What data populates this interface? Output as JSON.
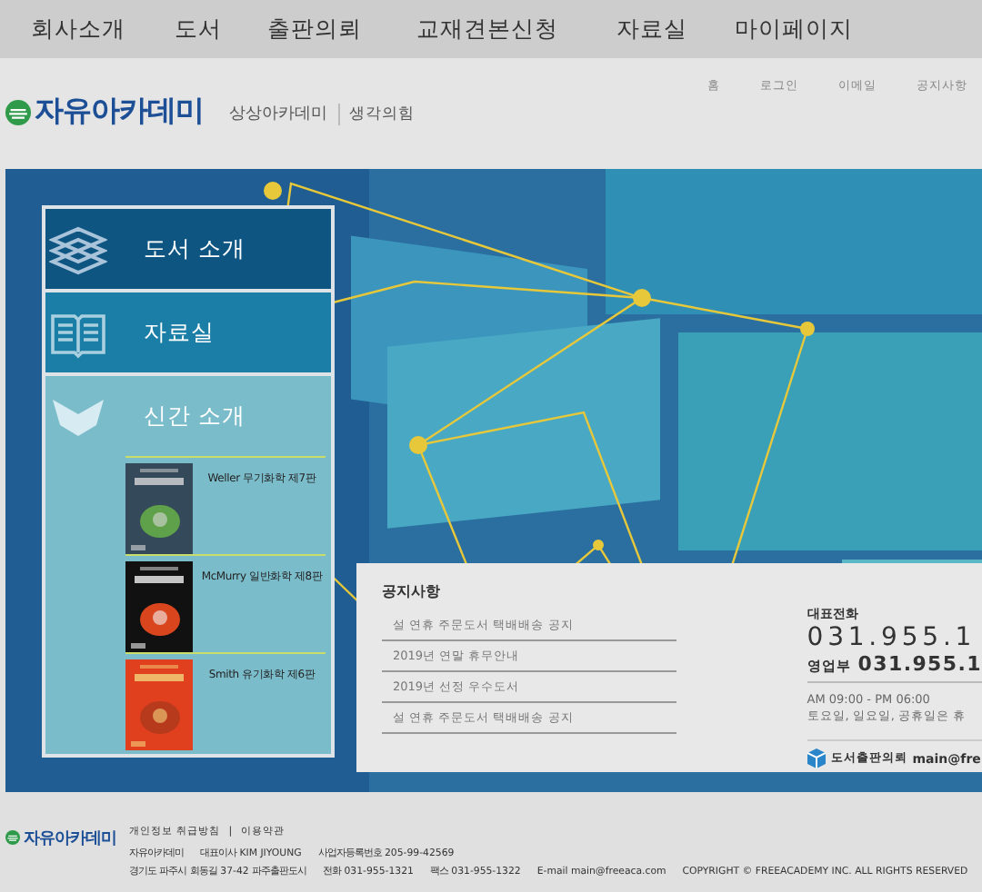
{
  "nav": {
    "items": [
      "회사소개",
      "도서",
      "출판의뢰",
      "교재견본신청",
      "자료실",
      "마이페이지"
    ]
  },
  "header": {
    "logo": "자유아카데미",
    "brands": [
      "상상아카데미",
      "생각의힘"
    ],
    "links": [
      "홈",
      "로그인",
      "이메일",
      "공지사항"
    ]
  },
  "sidebar": {
    "items": [
      {
        "label": "도서 소개",
        "kind": "books",
        "color": "#0e5582"
      },
      {
        "label": "자료실",
        "kind": "book",
        "color": "#1b7ea6"
      },
      {
        "label": "신간 소개",
        "kind": "new",
        "color": "#7bbccb"
      }
    ],
    "new_books": [
      {
        "title": "Weller 무기화학 제7판",
        "kind": "picture"
      },
      {
        "title": "McMurry 일반화학 제8판",
        "kind": "picture"
      },
      {
        "title": "Smith 유기화학 제6판",
        "kind": "picture"
      }
    ]
  },
  "notices": {
    "title": "공지사항",
    "items": [
      "설 연휴 주문도서 택배배송 공지",
      "2019년 연말 휴무안내",
      "2019년 선정 우수도서",
      "설 연휴 주문도서 택배배송 공지"
    ]
  },
  "contact": {
    "label": "대표전화",
    "phone": "031.955.1",
    "sales_label": "영업부",
    "sales_phone": "031.955.1",
    "hours": "AM 09:00 - PM 06:00",
    "closed": "토요일, 일요일, 공휴일은 휴",
    "request_label": "도서출판의뢰",
    "request_email": "main@fre"
  },
  "footer": {
    "logo": "자유아카데미",
    "links": [
      "개인정보 취급방침",
      "이용약관"
    ],
    "separator": "|",
    "line_1": [
      "자유아카데미",
      "대표이사 KIM JIYOUNG",
      "사업자등록번호 205-99-42569"
    ],
    "line_2": [
      "경기도 파주시 회동길 37-42 파주출판도시",
      "전화 031-955-1321",
      "팩스 031-955-1322",
      "E-mail main@freeaca.com",
      "COPYRIGHT © FREEACADEMY INC. ALL RIGHTS RESERVED"
    ]
  }
}
